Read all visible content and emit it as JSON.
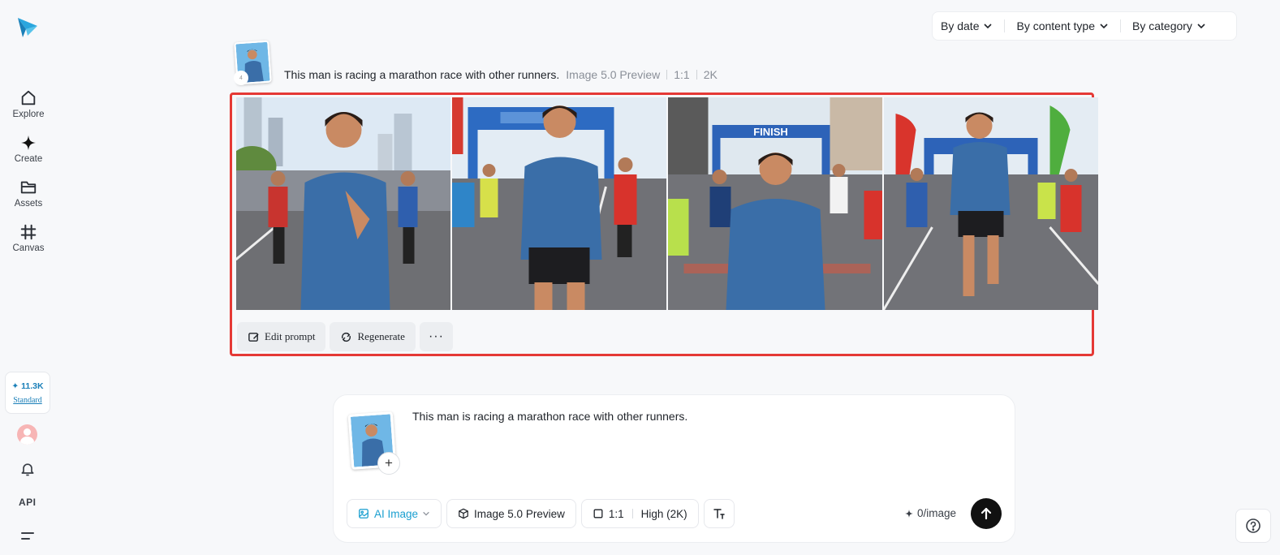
{
  "sidebar": {
    "logo_icon": "paper-plane-logo",
    "items": [
      {
        "label": "Explore",
        "icon": "home-icon"
      },
      {
        "label": "Create",
        "icon": "sparkle-icon"
      },
      {
        "label": "Assets",
        "icon": "folder-icon"
      },
      {
        "label": "Canvas",
        "icon": "grid-icon"
      }
    ],
    "credits": {
      "amount": "✦ 11.3K",
      "plan": "Standard"
    },
    "api_label": "API"
  },
  "filters": {
    "by_date": "By date",
    "by_content_type": "By content type",
    "by_category": "By category"
  },
  "result": {
    "prompt": "This man is racing a marathon race with other runners.",
    "model": "Image 5.0 Preview",
    "ratio": "1:1",
    "resolution": "2K",
    "thumb_badge": "4",
    "images": [
      {
        "alt": "Runner in blue shirt racing marathon, city skyline background"
      },
      {
        "alt": "Runner in blue shirt in front of blue arch banner"
      },
      {
        "alt": "Runner in blue shirt under FINISH banner",
        "banner": "FINISH"
      },
      {
        "alt": "Runner in blue shirt with red flags and blue arch"
      }
    ],
    "actions": {
      "edit_prompt": "Edit prompt",
      "regenerate": "Regenerate",
      "more": "···"
    }
  },
  "composer": {
    "text": "This man is racing a marathon race with other runners.",
    "plus": "+",
    "toolbar": {
      "mode": "AI Image",
      "model": "Image 5.0 Preview",
      "ratio": "1:1",
      "quality": "High (2K)"
    },
    "cost": "0/image"
  },
  "colors": {
    "accent": "#1a9fd0",
    "highlight_border": "#e53935",
    "send_button": "#111111"
  }
}
